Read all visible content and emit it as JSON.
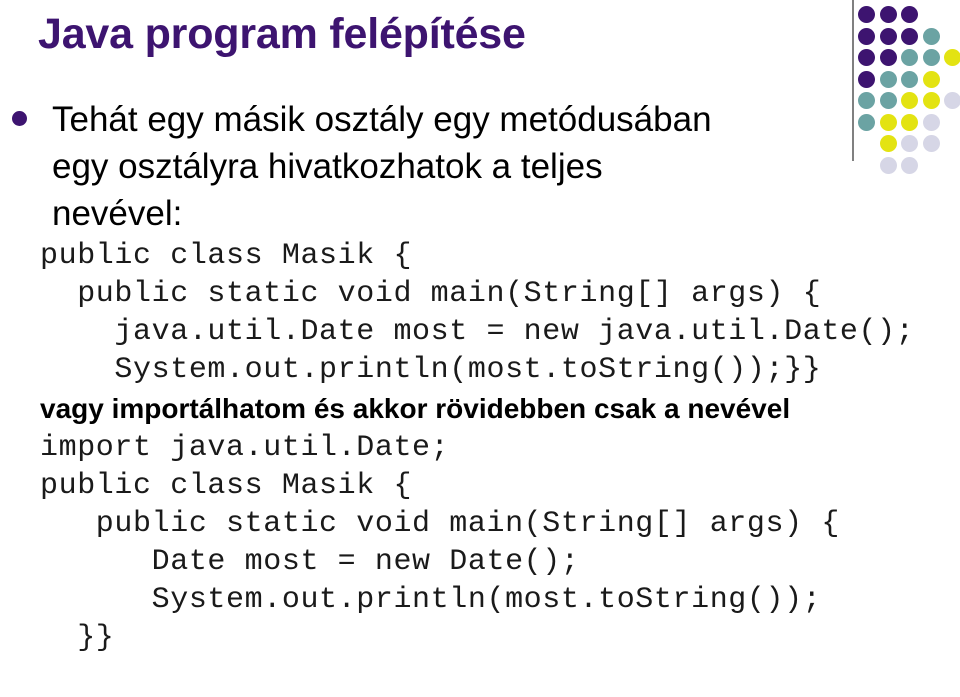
{
  "slide": {
    "title": "Java program felépítése",
    "title_color": "#3d1470",
    "background_color": "#ffffff",
    "body_text_color": "#000000"
  },
  "decoration": {
    "name": "corner-dot-grid",
    "rule_color": "#808080",
    "colors": {
      "purple": "#3d1470",
      "teal": "#6ba3a3",
      "yellow": "#e3e312",
      "lavender": "#d6d6e6"
    },
    "grid": [
      [
        "purple",
        "purple",
        "purple",
        "",
        ""
      ],
      [
        "purple",
        "purple",
        "purple",
        "teal",
        ""
      ],
      [
        "purple",
        "purple",
        "teal",
        "teal",
        "yellow"
      ],
      [
        "purple",
        "teal",
        "teal",
        "yellow",
        ""
      ],
      [
        "teal",
        "teal",
        "yellow",
        "yellow",
        "lavender"
      ],
      [
        "teal",
        "yellow",
        "yellow",
        "lavender",
        ""
      ],
      [
        "",
        "yellow",
        "lavender",
        "lavender",
        ""
      ],
      [
        "",
        "lavender",
        "lavender",
        "",
        ""
      ]
    ]
  },
  "content": {
    "bullet": {
      "marker": "filled-circle",
      "lines": [
        "Tehát egy másik osztály egy metódusában",
        "egy osztályra hivatkozhatok a teljes",
        "nevével:"
      ],
      "text": "Tehát egy másik osztály egy metódusában egy osztályra hivatkozhatok a teljes nevével:"
    },
    "code_block_1": [
      "public class Masik {",
      "  public static void main(String[] args) {",
      "    java.util.Date most = new java.util.Date();",
      "    System.out.println(most.toString());}}"
    ],
    "note": "vagy importálhatom és akkor rövidebben csak a nevével",
    "code_block_2": [
      "import java.util.Date;",
      "public class Masik {",
      "   public static void main(String[] args) {",
      "      Date most = new Date();",
      "      System.out.println(most.toString());",
      "  }}"
    ]
  }
}
